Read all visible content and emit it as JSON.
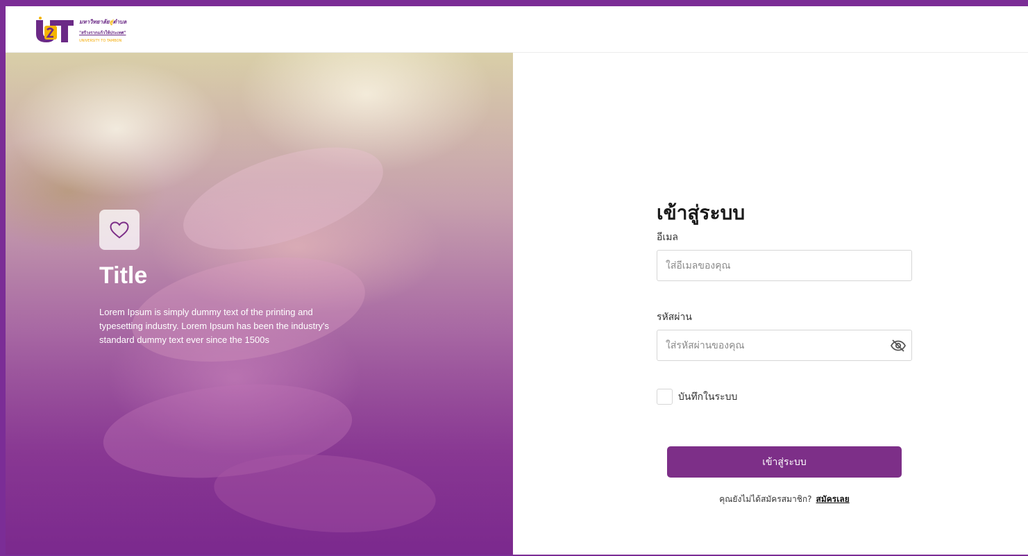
{
  "logo": {
    "mark_text": "U2T",
    "line1_a": "มหาวิทยาลัย",
    "line1_b": "สู่",
    "line1_c": "ตำบล",
    "line2": "\"สร้างรากแก้วให้ประเทศ\"",
    "line3": "UNIVERSITY TO TAMBON"
  },
  "hero": {
    "icon": "heart-icon",
    "title": "Title",
    "description": "Lorem Ipsum is simply dummy text of the printing and typesetting industry. Lorem Ipsum has been the industry's standard dummy text ever since the 1500s"
  },
  "login": {
    "title": "เข้าสู่ระบบ",
    "email_label": "อีเมล",
    "email_placeholder": "ใส่อีเมลของคุณ",
    "password_label": "รหัสผ่าน",
    "password_placeholder": "ใส่รหัสผ่านของคุณ",
    "password_toggle_icon": "eye-off-icon",
    "remember_label": "บันทึกในระบบ",
    "submit_label": "เข้าสู่ระบบ",
    "signup_prompt": "คุณยังไม่ได้สมัครสมาชิก?",
    "signup_link": "สมัครเลย"
  },
  "colors": {
    "brand_purple": "#7d2f88",
    "border_purple": "#7b2d96",
    "logo_yellow": "#f4b400"
  }
}
